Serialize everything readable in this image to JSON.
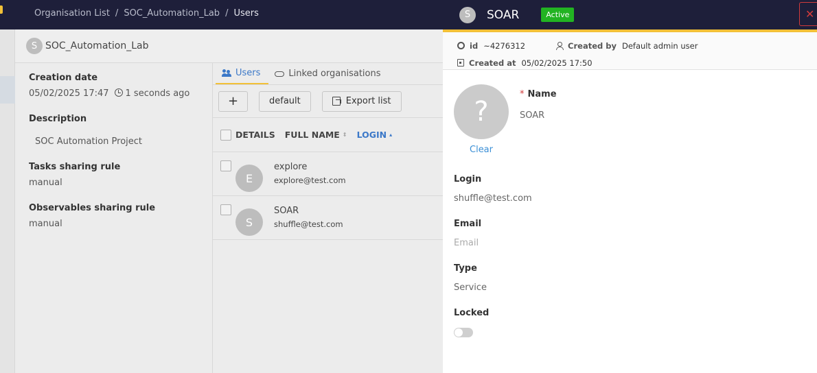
{
  "breadcrumb": {
    "item1": "Organisation List",
    "item2": "SOC_Automation_Lab",
    "item3": "Users"
  },
  "org": {
    "avatar_letter": "S",
    "title": "SOC_Automation_Lab",
    "creation_label": "Creation date",
    "creation_date": "05/02/2025 17:47",
    "creation_ago": "1 seconds ago",
    "description_label": "Description",
    "description": "SOC Automation Project",
    "tasks_rule_label": "Tasks sharing rule",
    "tasks_rule": "manual",
    "observables_rule_label": "Observables sharing rule",
    "observables_rule": "manual"
  },
  "tabs": {
    "users": "Users",
    "linked": "Linked organisations"
  },
  "toolbar": {
    "add": "+",
    "profile": "default",
    "export": "Export list"
  },
  "table": {
    "headers": {
      "details": "DETAILS",
      "full_name": "FULL NAME",
      "login": "LOGIN"
    },
    "rows": [
      {
        "avatar": "E",
        "name": "explore",
        "email": "explore@test.com"
      },
      {
        "avatar": "S",
        "name": "SOAR",
        "email": "shuffle@test.com"
      }
    ]
  },
  "drawer": {
    "avatar_letter": "S",
    "title": "SOAR",
    "status": "Active",
    "close": "✕",
    "meta": {
      "id_label": "id",
      "id_value": "~4276312",
      "created_by_label": "Created by",
      "created_by_value": "Default admin user",
      "created_at_label": "Created at",
      "created_at_value": "05/02/2025 17:50"
    },
    "avatar_placeholder": "?",
    "clear": "Clear",
    "required_mark": "*",
    "name_label": "Name",
    "name_value": "SOAR",
    "login_label": "Login",
    "login_value": "shuffle@test.com",
    "email_label": "Email",
    "email_placeholder": "Email",
    "type_label": "Type",
    "type_value": "Service",
    "locked_label": "Locked",
    "locked": false
  },
  "colors": {
    "navbar": "#1e1f3a",
    "accent_yellow": "#f2c037",
    "link_blue": "#3b78c8",
    "active_green": "#22b322",
    "close_red": "#d23b3b"
  }
}
